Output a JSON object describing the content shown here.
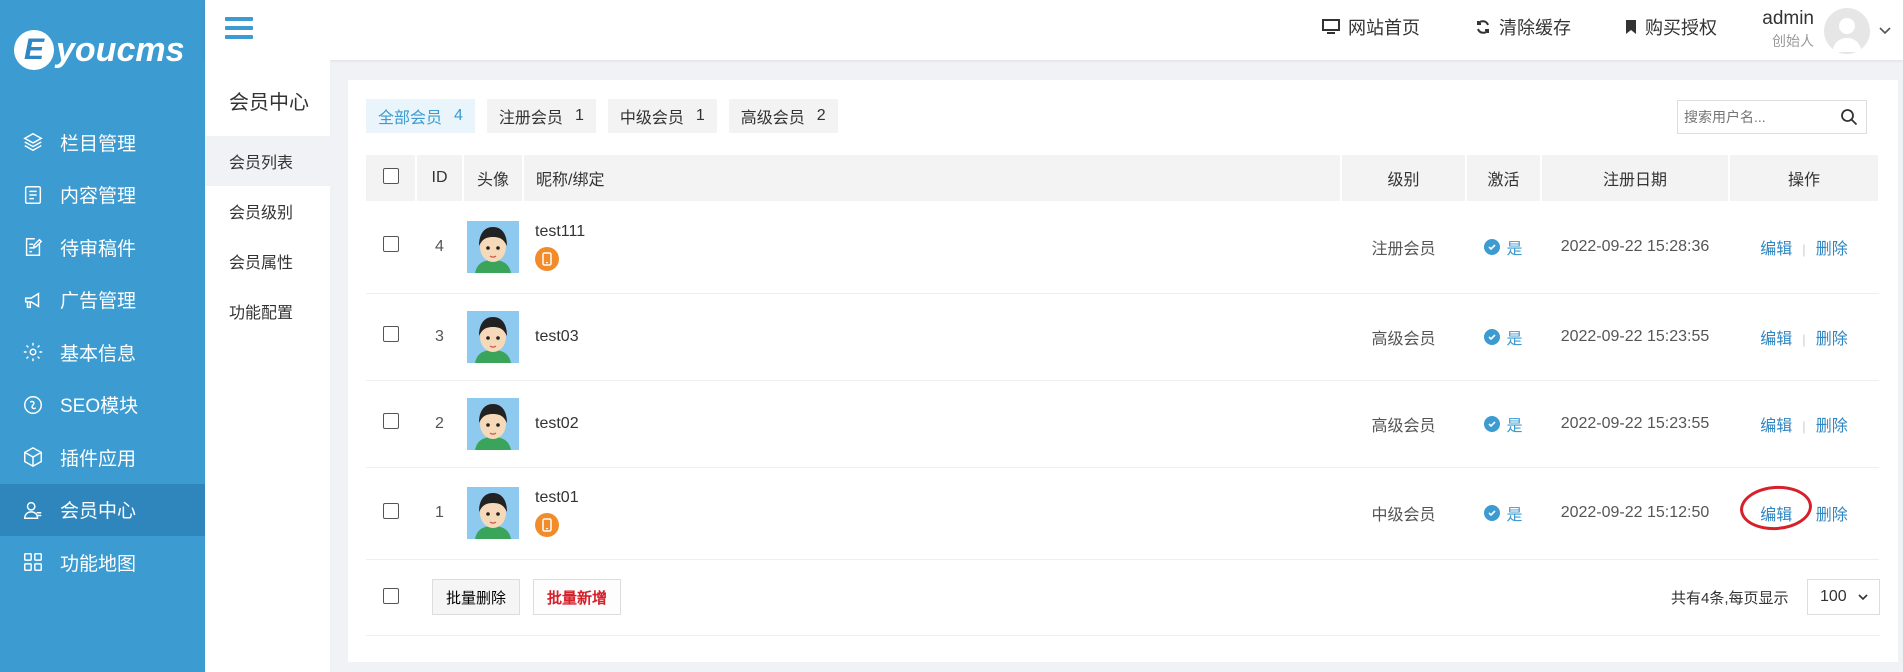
{
  "brand": {
    "logo_letter": "E",
    "logo_text": "youcms"
  },
  "sidebar": {
    "items": [
      {
        "label": "栏目管理",
        "icon": "layers-icon"
      },
      {
        "label": "内容管理",
        "icon": "document-icon"
      },
      {
        "label": "待审稿件",
        "icon": "edit-doc-icon"
      },
      {
        "label": "广告管理",
        "icon": "megaphone-icon"
      },
      {
        "label": "基本信息",
        "icon": "gear-icon"
      },
      {
        "label": "SEO模块",
        "icon": "seo-icon"
      },
      {
        "label": "插件应用",
        "icon": "cube-icon"
      },
      {
        "label": "会员中心",
        "icon": "user-icon",
        "active": true
      },
      {
        "label": "功能地图",
        "icon": "grid-icon"
      }
    ]
  },
  "header": {
    "links": {
      "home": "网站首页",
      "clear_cache": "清除缓存",
      "buy_license": "购买授权"
    },
    "user": {
      "name": "admin",
      "role": "创始人"
    }
  },
  "subnav": {
    "title": "会员中心",
    "items": [
      {
        "label": "会员列表",
        "active": true
      },
      {
        "label": "会员级别"
      },
      {
        "label": "会员属性"
      },
      {
        "label": "功能配置"
      }
    ]
  },
  "filters": [
    {
      "label": "全部会员",
      "count": "4",
      "active": true
    },
    {
      "label": "注册会员",
      "count": "1"
    },
    {
      "label": "中级会员",
      "count": "1"
    },
    {
      "label": "高级会员",
      "count": "2"
    }
  ],
  "search": {
    "placeholder": "搜索用户名..."
  },
  "table": {
    "headers": {
      "id": "ID",
      "avatar": "头像",
      "nickname": "昵称/绑定",
      "level": "级别",
      "active": "激活",
      "reg_date": "注册日期",
      "ops": "操作"
    },
    "rows": [
      {
        "id": "4",
        "nickname": "test111",
        "mobile_bound": true,
        "level": "注册会员",
        "active": "是",
        "reg_date": "2022-09-22 15:28:36",
        "edit": "编辑",
        "delete": "删除"
      },
      {
        "id": "3",
        "nickname": "test03",
        "mobile_bound": false,
        "level": "高级会员",
        "active": "是",
        "reg_date": "2022-09-22 15:23:55",
        "edit": "编辑",
        "delete": "删除"
      },
      {
        "id": "2",
        "nickname": "test02",
        "mobile_bound": false,
        "level": "高级会员",
        "active": "是",
        "reg_date": "2022-09-22 15:23:55",
        "edit": "编辑",
        "delete": "删除"
      },
      {
        "id": "1",
        "nickname": "test01",
        "mobile_bound": true,
        "level": "中级会员",
        "active": "是",
        "reg_date": "2022-09-22 15:12:50",
        "edit": "编辑",
        "delete": "删除",
        "edit_highlighted": true
      }
    ]
  },
  "footer": {
    "batch_delete": "批量删除",
    "batch_add": "批量新增",
    "total_text": "共有4条,每页显示",
    "page_size": "100"
  },
  "colors": {
    "primary": "#3c9bd1",
    "sidebar_active": "#2f86bd",
    "annotation": "#d6202a",
    "bind_badge": "#f28b2a"
  }
}
